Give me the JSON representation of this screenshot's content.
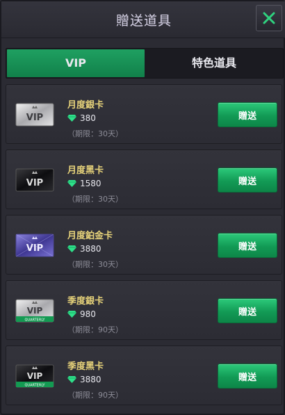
{
  "header": {
    "title": "贈送道具"
  },
  "tabs": [
    {
      "label": "VIP",
      "active": true
    },
    {
      "label": "特色道具",
      "active": false
    }
  ],
  "items": [
    {
      "name": "月度銀卡",
      "price": "380",
      "period": "（期限：30天）",
      "button": "贈送",
      "card_style": "silver",
      "card_text": "VIP"
    },
    {
      "name": "月度黑卡",
      "price": "1580",
      "period": "（期限：30天）",
      "button": "贈送",
      "card_style": "black",
      "card_text": "VIP"
    },
    {
      "name": "月度鉑金卡",
      "price": "3880",
      "period": "（期限：30天）",
      "button": "贈送",
      "card_style": "platinum",
      "card_text": "VIP"
    },
    {
      "name": "季度銀卡",
      "price": "980",
      "period": "（期限：90天）",
      "button": "贈送",
      "card_style": "silver-quarterly",
      "card_text": "VIP",
      "card_sub": "QUARTERLY"
    },
    {
      "name": "季度黑卡",
      "price": "3880",
      "period": "（期限：90天）",
      "button": "贈送",
      "card_style": "black-quarterly",
      "card_text": "VIP",
      "card_sub": "QUARTERLY"
    }
  ],
  "colors": {
    "accent_green": "#18a05c",
    "item_name": "#e6d27a",
    "gem": "#2ee08a",
    "close_icon": "#2fd27f"
  },
  "icons": {
    "close": "close-icon",
    "gem": "diamond-icon",
    "crown": "crown-icon"
  }
}
